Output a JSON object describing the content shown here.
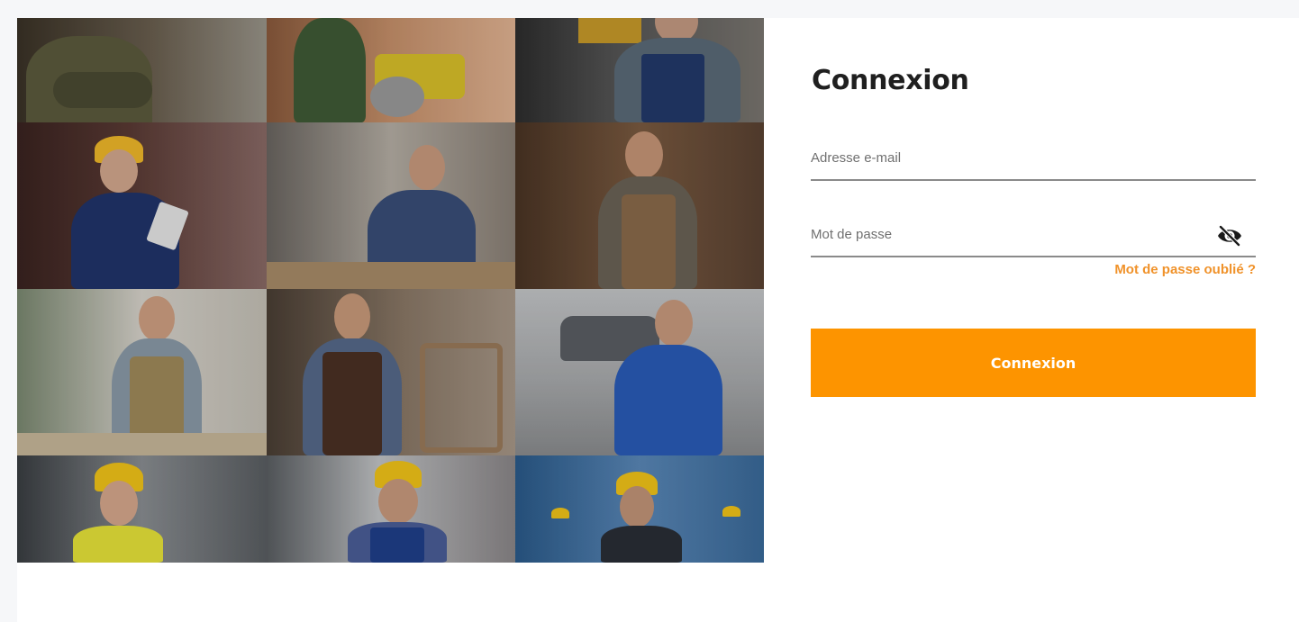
{
  "login": {
    "title": "Connexion",
    "email_placeholder": "Adresse e-mail",
    "email_value": "",
    "password_placeholder": "Mot de passe",
    "password_value": "",
    "toggle_icon": "eye-off-icon",
    "forgot_label": "Mot de passe oublié ?",
    "submit_label": "Connexion"
  },
  "colors": {
    "accent": "#fd9400",
    "link": "#f0922a",
    "title": "#1f1f1f",
    "underline": "#8a8a8a"
  },
  "gallery": {
    "tiles": [
      "worker-arms-crossed-jacket",
      "carpenter-miter-saw",
      "mechanic-leaning-on-handlebar",
      "engineer-with-tablet-hardhat",
      "carpenter-at-workbench",
      "craftsman-apron-arms-crossed",
      "woodworker-with-sander",
      "carpenter-with-drill",
      "mechanic-blue-overalls-garage",
      "worker-safety-vest-hardhat",
      "worker-blue-overalls-hardhat",
      "engineer-hardhat-factory"
    ]
  }
}
